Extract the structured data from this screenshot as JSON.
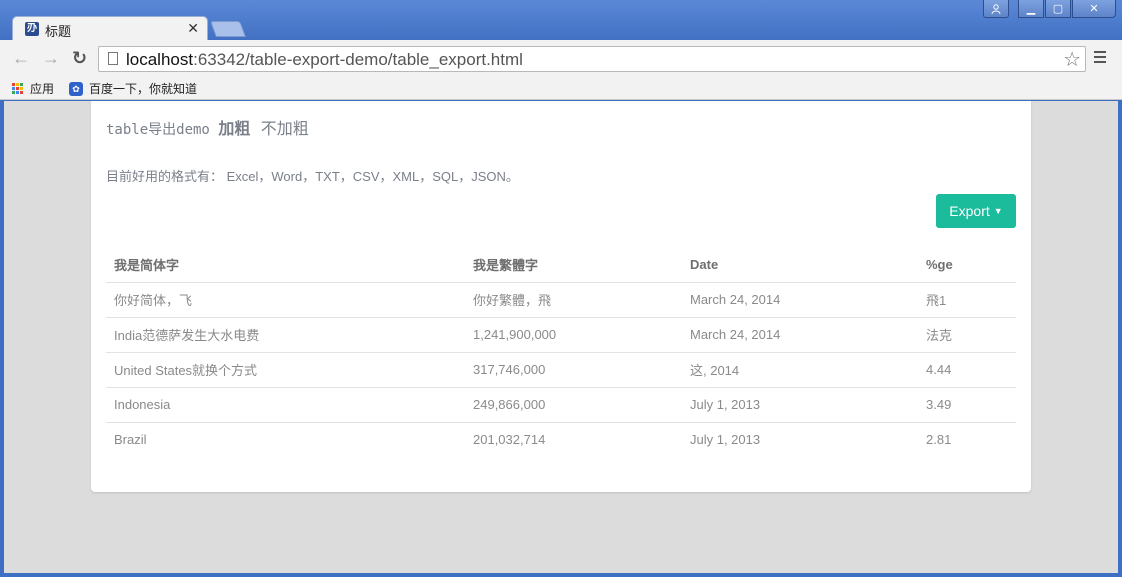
{
  "browser": {
    "tab_title": "标题",
    "tab_favicon": "刅",
    "url_host": "localhost",
    "url_rest": ":63342/table-export-demo/table_export.html",
    "bookmarks": [
      {
        "label": "应用",
        "icon": "apps-grid-icon"
      },
      {
        "label": "百度一下，你就知道",
        "icon": "baidu-paw-icon"
      }
    ]
  },
  "page": {
    "heading_mono": "table导出demo",
    "heading_bold": "加粗",
    "heading_normal": "不加粗",
    "formats_text": "目前好用的格式有： Excel，Word，TXT，CSV，XML，SQL，JSON。",
    "export_label": "Export"
  },
  "table": {
    "headers": [
      "我是简体字",
      "我是繁體字",
      "Date",
      "%ge"
    ],
    "rows": [
      [
        "你好简体，飞",
        "你好繁體，飛",
        "March 24, 2014",
        "飛1"
      ],
      [
        "India范德萨发生大水电费",
        "1,241,900,000",
        "March 24, 2014",
        "法克"
      ],
      [
        "United States就换个方式",
        "317,746,000",
        "这, 2014",
        "4.44"
      ],
      [
        "Indonesia",
        "249,866,000",
        "July 1, 2013",
        "3.49"
      ],
      [
        "Brazil",
        "201,032,714",
        "July 1, 2013",
        "2.81"
      ]
    ]
  },
  "colors": {
    "accent": "#1abc9c",
    "window_frame": "#3f6fc4"
  }
}
